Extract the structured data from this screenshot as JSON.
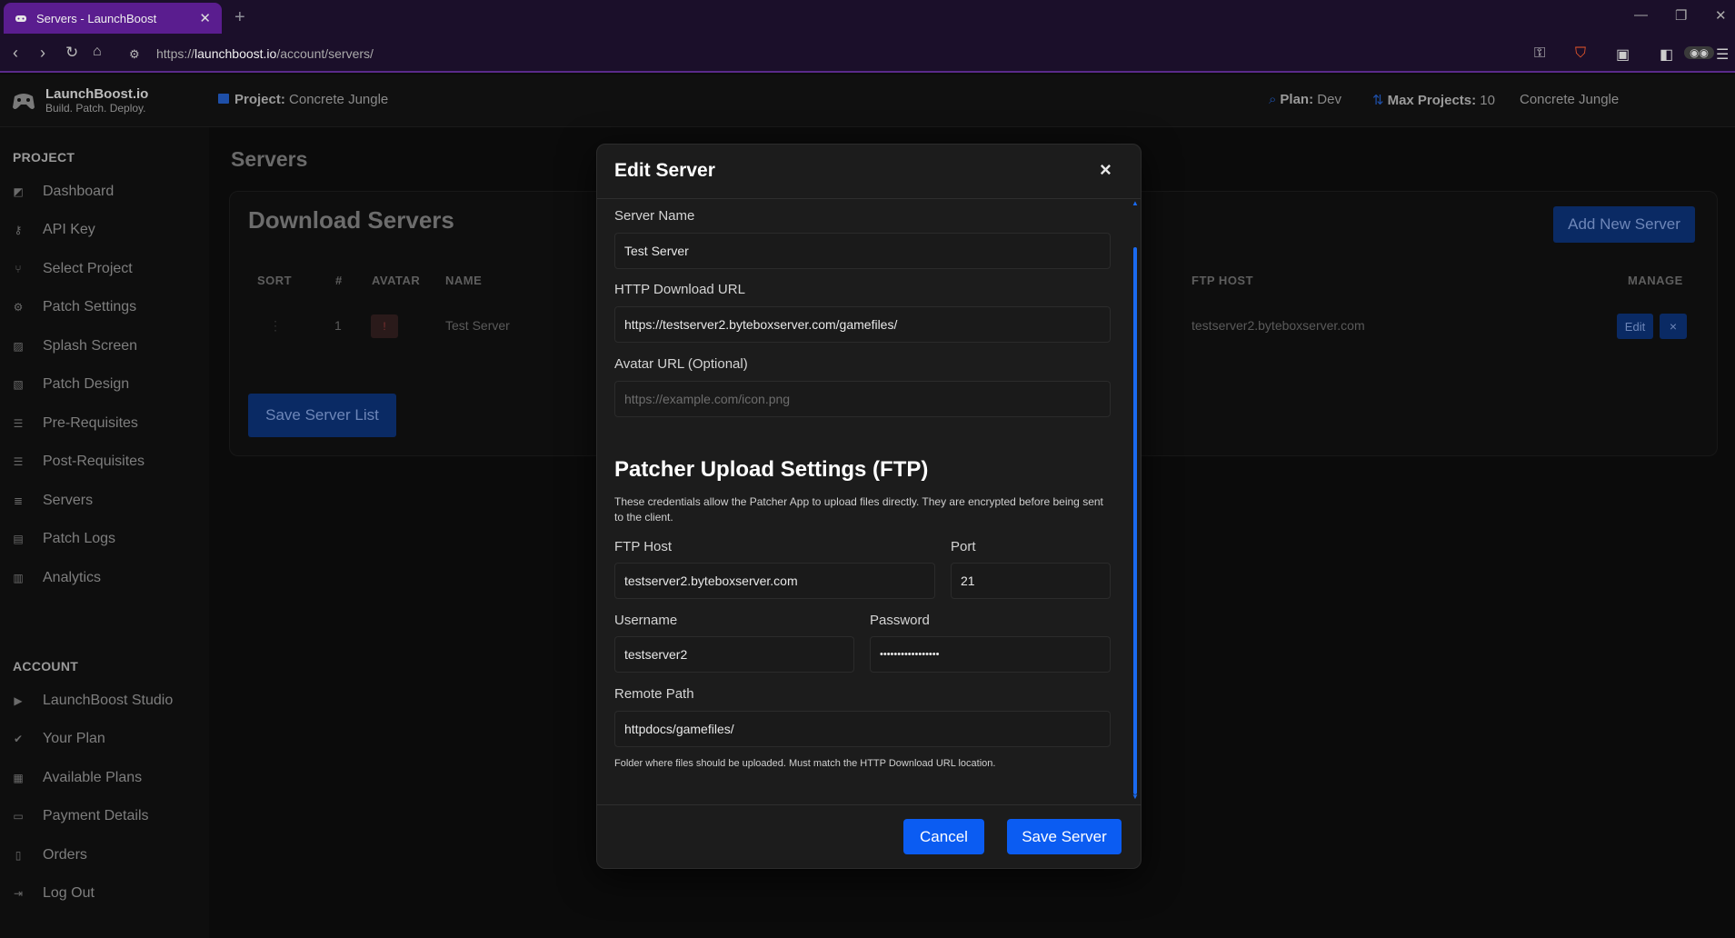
{
  "browser": {
    "tab_title": "Servers - LaunchBoost",
    "url_host": "launchboost.io",
    "url_prefix": "https://",
    "url_path": "/account/servers/"
  },
  "header": {
    "brand": "LaunchBoost.io",
    "tagline": "Build. Patch. Deploy.",
    "project_key": "Project:",
    "project_value": "Concrete Jungle",
    "plan_key": "Plan:",
    "plan_value": "Dev",
    "max_projects_key": "Max Projects:",
    "max_projects_value": "10",
    "project_selector": "Concrete Jungle"
  },
  "sidebar": {
    "project_heading": "PROJECT",
    "project_items": [
      {
        "label": "Dashboard",
        "icon": "dashboard-icon"
      },
      {
        "label": "API Key",
        "icon": "key-icon"
      },
      {
        "label": "Select Project",
        "icon": "branch-icon"
      },
      {
        "label": "Patch Settings",
        "icon": "gear-icon"
      },
      {
        "label": "Splash Screen",
        "icon": "image-icon"
      },
      {
        "label": "Patch Design",
        "icon": "images-icon"
      },
      {
        "label": "Pre-Requisites",
        "icon": "list-icon"
      },
      {
        "label": "Post-Requisites",
        "icon": "list-icon"
      },
      {
        "label": "Servers",
        "icon": "server-icon"
      },
      {
        "label": "Patch Logs",
        "icon": "file-icon"
      },
      {
        "label": "Analytics",
        "icon": "chart-icon"
      }
    ],
    "account_heading": "ACCOUNT",
    "account_items": [
      {
        "label": "LaunchBoost Studio",
        "icon": "play-icon"
      },
      {
        "label": "Your Plan",
        "icon": "check-icon"
      },
      {
        "label": "Available Plans",
        "icon": "table-icon"
      },
      {
        "label": "Payment Details",
        "icon": "card-icon"
      },
      {
        "label": "Orders",
        "icon": "receipt-icon"
      },
      {
        "label": "Log Out",
        "icon": "logout-icon"
      }
    ]
  },
  "main": {
    "page_title": "Servers",
    "card_title": "Download Servers",
    "add_button": "Add New Server",
    "columns": [
      "SORT",
      "#",
      "AVATAR",
      "NAME",
      "FTP HOST",
      "MANAGE"
    ],
    "row": {
      "index": "1",
      "avatar": "!",
      "name": "Test Server",
      "ftp_host": "testserver2.byteboxserver.com",
      "edit": "Edit",
      "delete": "×"
    },
    "save_list_button": "Save Server List"
  },
  "modal": {
    "title": "Edit Server",
    "close": "×",
    "server_name_label": "Server Name",
    "server_name_value": "Test Server",
    "http_url_label": "HTTP Download URL",
    "http_url_value": "https://testserver2.byteboxserver.com/gamefiles/",
    "avatar_url_label": "Avatar URL (Optional)",
    "avatar_url_placeholder": "https://example.com/icon.png",
    "ftp_section_title": "Patcher Upload Settings (FTP)",
    "ftp_section_desc": "These credentials allow the Patcher App to upload files directly. They are encrypted before being sent to the client.",
    "ftp_host_label": "FTP Host",
    "ftp_host_value": "testserver2.byteboxserver.com",
    "port_label": "Port",
    "port_value": "21",
    "username_label": "Username",
    "username_value": "testserver2",
    "password_label": "Password",
    "password_value": "•••••••••••••••••",
    "remote_path_label": "Remote Path",
    "remote_path_value": "httpdocs/gamefiles/",
    "remote_path_help": "Folder where files should be uploaded. Must match the HTTP Download URL location.",
    "cancel_button": "Cancel",
    "save_button": "Save Server"
  },
  "colors": {
    "accent_blue": "#0b5cf2",
    "browser_purple": "#5a1d8f"
  }
}
